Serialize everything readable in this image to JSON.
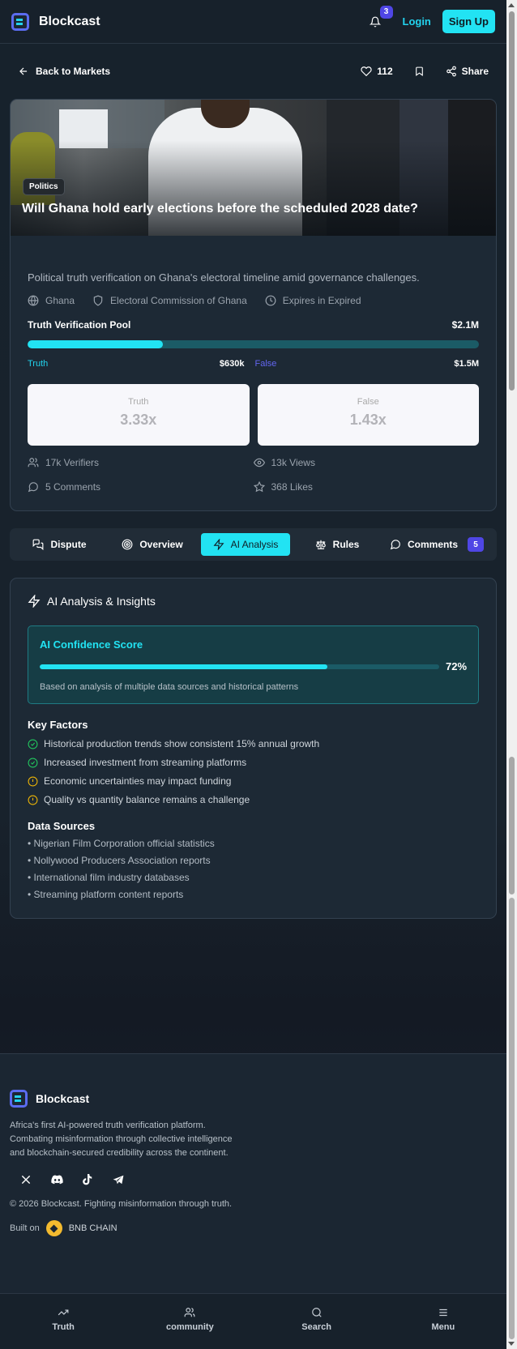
{
  "header": {
    "brand": "Blockcast",
    "notification_count": "3",
    "login": "Login",
    "signup": "Sign Up"
  },
  "nav": {
    "back": "Back to Markets",
    "likes": "112",
    "share": "Share"
  },
  "market": {
    "category": "Politics",
    "title": "Will Ghana hold early elections before the scheduled 2028 date?",
    "description": "Political truth verification on Ghana's electoral timeline amid governance challenges.",
    "country": "Ghana",
    "source": "Electoral Commission of Ghana",
    "expires": "Expires in Expired",
    "pool_label": "Truth Verification Pool",
    "pool_total": "$2.1M",
    "truth_fraction": 0.3,
    "truth_label": "Truth",
    "truth_amount": "$630k",
    "false_label": "False",
    "false_amount": "$1.5M",
    "truth_odds_label": "Truth",
    "truth_odds": "3.33x",
    "false_odds_label": "False",
    "false_odds": "1.43x",
    "verifiers": "17k Verifiers",
    "views": "13k Views",
    "comments": "5 Comments",
    "likes": "368 Likes"
  },
  "tabs": [
    {
      "label": "Dispute",
      "icon": "dispute-icon"
    },
    {
      "label": "Overview",
      "icon": "target-icon"
    },
    {
      "label": "AI Analysis",
      "icon": "zap-icon",
      "active": true
    },
    {
      "label": "Rules",
      "icon": "scale-icon"
    },
    {
      "label": "Comments",
      "icon": "comment-icon",
      "badge": "5"
    }
  ],
  "analysis": {
    "title": "AI Analysis & Insights",
    "confidence_title": "AI Confidence Score",
    "confidence_value": 0.72,
    "confidence_text": "72%",
    "confidence_note": "Based on analysis of multiple data sources and historical patterns",
    "key_factors_title": "Key Factors",
    "key_factors": [
      {
        "text": "Historical production trends show consistent 15% annual growth",
        "status": "positive"
      },
      {
        "text": "Increased investment from streaming platforms",
        "status": "positive"
      },
      {
        "text": "Economic uncertainties may impact funding",
        "status": "warning"
      },
      {
        "text": "Quality vs quantity balance remains a challenge",
        "status": "warning"
      }
    ],
    "data_sources_title": "Data Sources",
    "data_sources": [
      "• Nigerian Film Corporation official statistics",
      "• Nollywood Producers Association reports",
      "• International film industry databases",
      "• Streaming platform content reports"
    ]
  },
  "footer": {
    "brand": "Blockcast",
    "description": "Africa's first AI-powered truth verification platform. Combating misinformation through collective intelligence and blockchain-secured credibility across the continent.",
    "copyright": "© 2026 Blockcast. Fighting misinformation through truth.",
    "built_on": "Built on",
    "chain": "BNB CHAIN",
    "socials": [
      "x-icon",
      "discord-icon",
      "tiktok-icon",
      "telegram-icon"
    ]
  },
  "bottom_nav": [
    {
      "label": "Truth",
      "icon": "trending-icon"
    },
    {
      "label": "community",
      "icon": "users-icon"
    },
    {
      "label": "Search",
      "icon": "search-icon"
    },
    {
      "label": "Menu",
      "icon": "menu-icon"
    }
  ],
  "colors": {
    "accent": "#22e3f3",
    "indigo": "#4f46e5",
    "positive": "#22c55e",
    "warning": "#eab308"
  }
}
